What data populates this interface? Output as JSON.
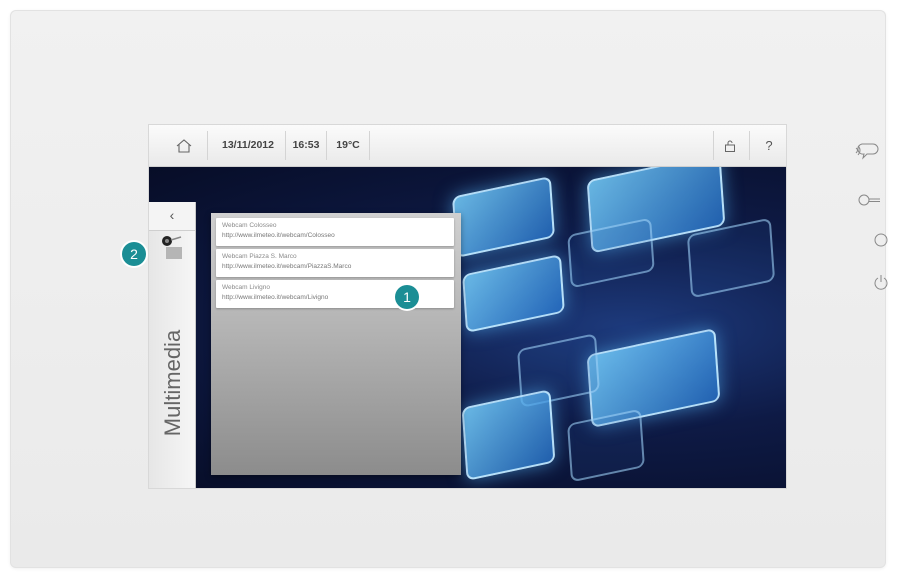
{
  "statusbar": {
    "date": "13/11/2012",
    "time": "16:53",
    "temperature": "19°C",
    "help_label": "?"
  },
  "sidebar": {
    "back_label": "‹",
    "title": "Multimedia"
  },
  "webcams": [
    {
      "name": "Webcam Colosseo",
      "url": "http://www.ilmeteo.it/webcam/Colosseo"
    },
    {
      "name": "Webcam Piazza S. Marco",
      "url": "http://www.ilmeteo.it/webcam/PiazzaS.Marco"
    },
    {
      "name": "Webcam Livigno",
      "url": "http://www.ilmeteo.it/webcam/Livigno"
    }
  ],
  "callouts": {
    "one": "1",
    "two": "2"
  },
  "colors": {
    "accent": "#1b8e95",
    "background_dark": "#0a1330"
  }
}
